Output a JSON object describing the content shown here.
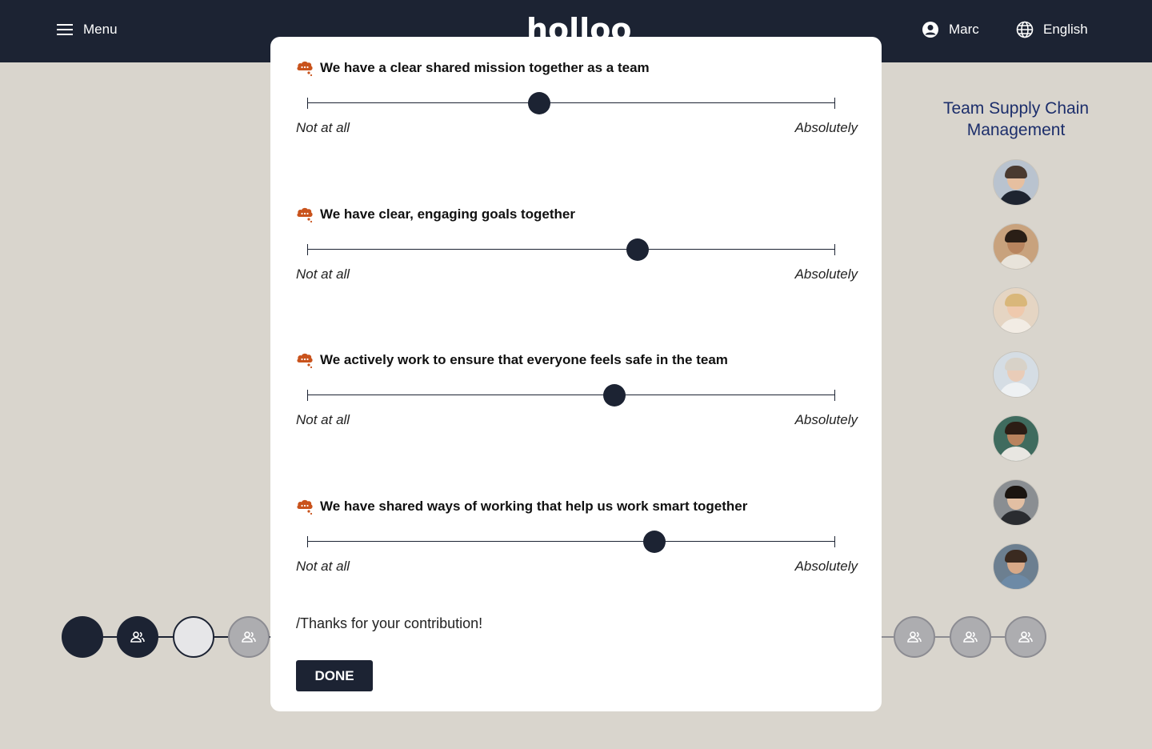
{
  "header": {
    "menu_label": "Menu",
    "logo_text": "holloo",
    "user_name": "Marc",
    "language": "English"
  },
  "team": {
    "title": "Team Supply Chain Management",
    "member_count": 7
  },
  "questions": [
    {
      "text": "We have a clear shared mission together as a team",
      "min_label": "Not at all",
      "max_label": "Absolutely",
      "value": 0.44
    },
    {
      "text": "We have clear, engaging goals together",
      "min_label": "Not at all",
      "max_label": "Absolutely",
      "value": 0.625
    },
    {
      "text": "We actively work to ensure that everyone feels safe in the team",
      "min_label": "Not at all",
      "max_label": "Absolutely",
      "value": 0.582
    },
    {
      "text": "We have shared ways of working that help us work smart together",
      "min_label": "Not at all",
      "max_label": "Absolutely",
      "value": 0.658
    }
  ],
  "footer": {
    "thanks": "/Thanks for your contribution!",
    "done_label": "DONE"
  },
  "colors": {
    "navy": "#1c2333",
    "accent_orange": "#c9531c",
    "background": "#d9d5cd",
    "team_title": "#1c2e6b"
  }
}
